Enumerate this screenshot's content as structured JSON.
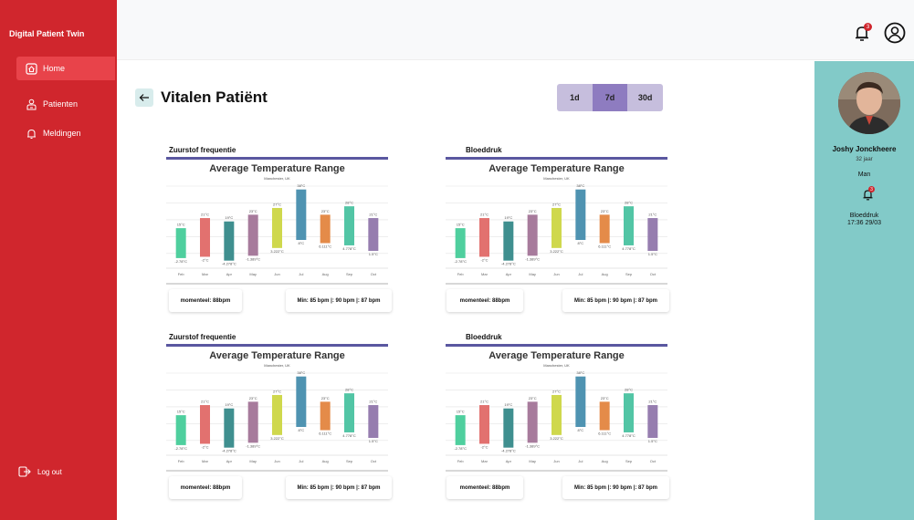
{
  "app": {
    "brand": "Digital Patient Twin"
  },
  "sidebar": {
    "items": [
      {
        "label": "Home",
        "icon": "home-icon"
      },
      {
        "label": "Patienten",
        "icon": "patients-icon"
      },
      {
        "label": "Meldingen",
        "icon": "bell-icon"
      }
    ],
    "logout_label": "Log out"
  },
  "header": {
    "notification_count": "3"
  },
  "page": {
    "title": "Vitalen Patiënt",
    "ranges": [
      "1d",
      "7d",
      "30d"
    ],
    "active_range": "7d"
  },
  "patient": {
    "name": "Joshy Jonckheere",
    "age": "32 jaar",
    "sex": "Man",
    "alert_count": "3",
    "last_alert_label": "Bloeddruk",
    "last_alert_time": "17:36 29/03"
  },
  "cards": [
    {
      "title": "Zuurstof frequentie",
      "current": "momenteel: 88bpm",
      "minmax": "Min:  85 bpm |: 90 bpm |: 87 bpm"
    },
    {
      "title": "Bloeddruk",
      "current": "momenteel: 88bpm",
      "minmax": "Min:  85 bpm |: 90 bpm |: 87 bpm"
    },
    {
      "title": "Zuurstof frequentie",
      "current": "momenteel: 88bpm",
      "minmax": "Min:  85 bpm |: 90 bpm |: 87 bpm"
    },
    {
      "title": "Bloeddruk",
      "current": "momenteel: 88bpm",
      "minmax": "Min:  85 bpm |: 90 bpm |: 87 bpm"
    }
  ],
  "chart_data": {
    "type": "bar",
    "title": "Average Temperature Range",
    "subtitle": "Manchester, UK",
    "categories": [
      "Feb",
      "Mar",
      "Apr",
      "May",
      "Jun",
      "Jul",
      "Aug",
      "Sep",
      "Oct"
    ],
    "high": [
      15,
      21,
      19,
      23,
      27,
      38,
      23,
      28,
      21
    ],
    "low": [
      -2.78,
      -2,
      -4.278,
      -1.389,
      3.222,
      8,
      6.111,
      4.778,
      1.5
    ],
    "high_labels": [
      "15°C",
      "21°C",
      "19°C",
      "23°C",
      "27°C",
      "38°C",
      "23°C",
      "28°C",
      "21°C"
    ],
    "low_labels": [
      "-2.78°C",
      "-2°C",
      "-4.278°C",
      "-1.389°C",
      "3.222°C",
      "8°C",
      "6.111°C",
      "4.778°C",
      "1.5°C"
    ],
    "colors": [
      "#4fcf9e",
      "#e2716f",
      "#3f8f8f",
      "#a77b9c",
      "#cfd84d",
      "#4f93b1",
      "#e48b49",
      "#52c5a5",
      "#967daf"
    ],
    "ylim": [
      -5,
      40
    ],
    "grid": true
  }
}
